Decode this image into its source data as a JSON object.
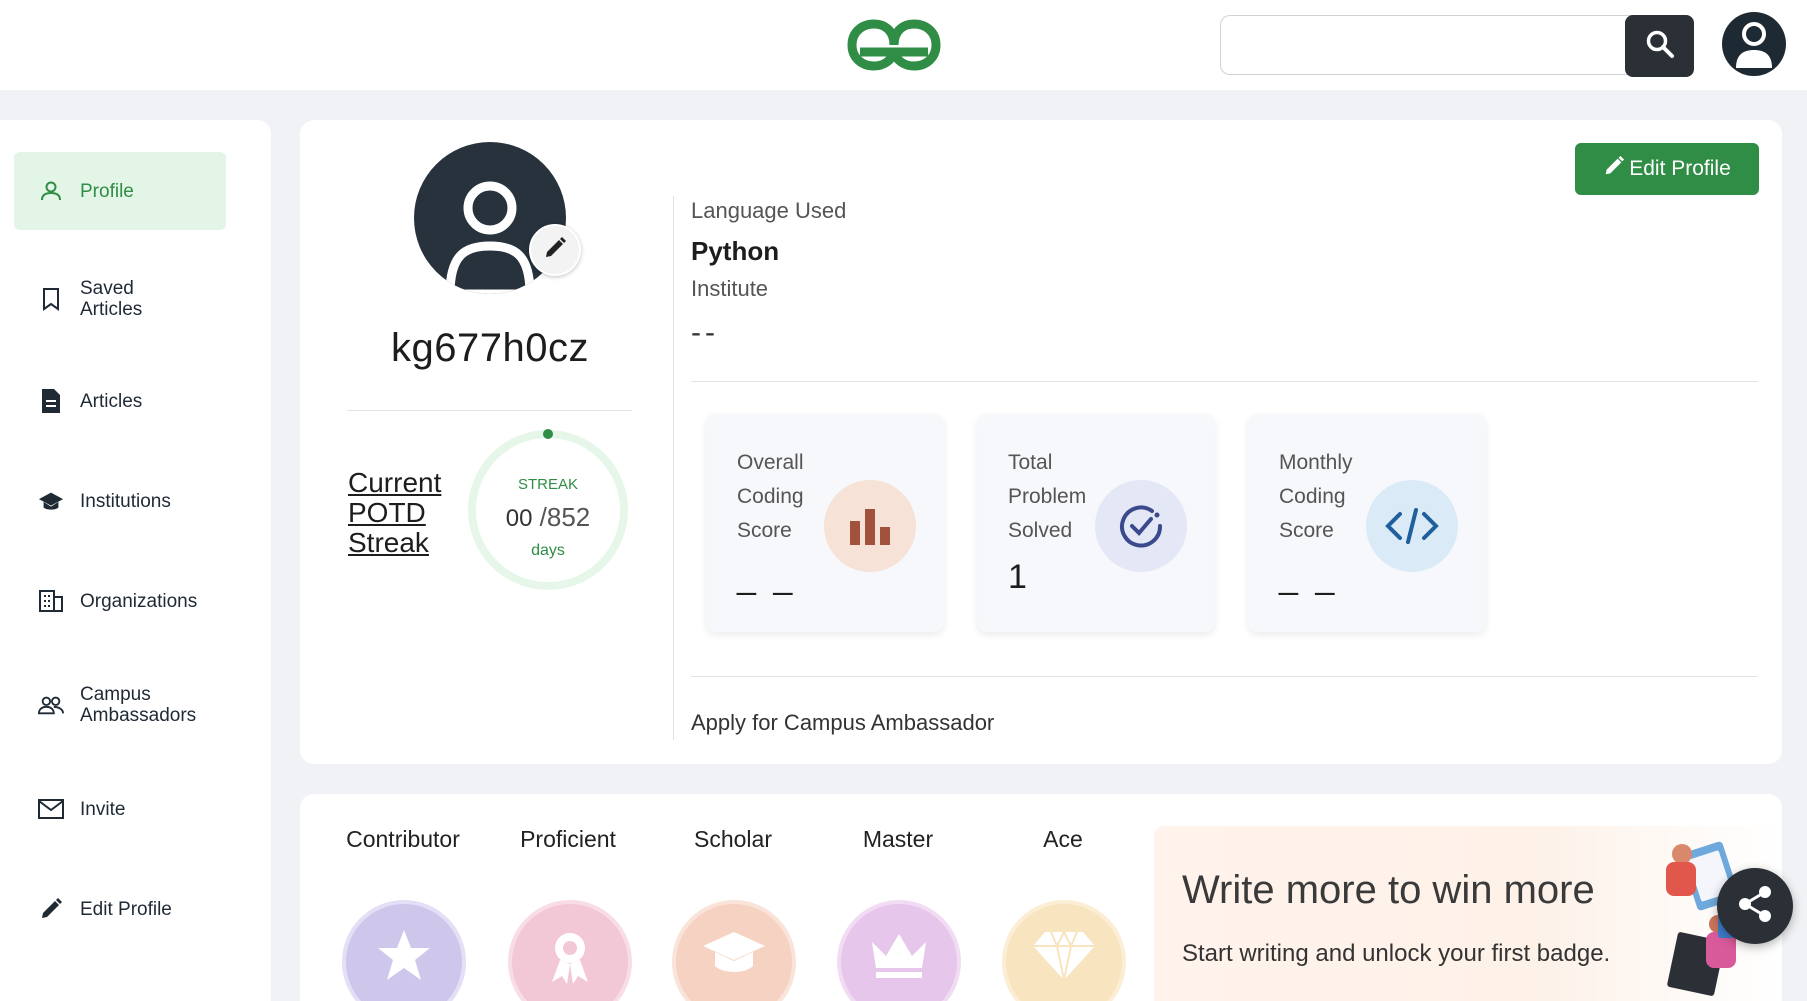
{
  "header": {
    "logo_icon": "gfg-logo-icon",
    "search_placeholder": "",
    "search_icon": "search-icon",
    "avatar_icon": "user-avatar-icon"
  },
  "sidebar": {
    "items": [
      {
        "label": "Profile",
        "icon": "user-icon",
        "active": true
      },
      {
        "label": "Saved Articles",
        "icon": "bookmark-icon"
      },
      {
        "label": "Articles",
        "icon": "document-icon"
      },
      {
        "label": "Institutions",
        "icon": "graduation-cap-icon"
      },
      {
        "label": "Organizations",
        "icon": "building-icon"
      },
      {
        "label": "Campus Ambassadors",
        "icon": "people-icon"
      },
      {
        "label": "Invite",
        "icon": "mail-icon"
      },
      {
        "label": "Edit Profile",
        "icon": "pencil-icon"
      }
    ]
  },
  "profile": {
    "username": "kg677h0cz",
    "potd_label": "Current POTD Streak",
    "streak_title": "STREAK",
    "streak_current": "00",
    "streak_total": "/852",
    "streak_unit": "days",
    "streak_progress": 0,
    "edit_button": "Edit Profile",
    "language_label": "Language Used",
    "language_value": "Python",
    "institute_label": "Institute",
    "institute_value": "--",
    "campus_link": "Apply for Campus Ambassador"
  },
  "stats": [
    {
      "label": "Overall Coding Score",
      "value": "_ _",
      "icon": "bar-chart-icon",
      "color": "#f6e2d6"
    },
    {
      "label": "Total Problem Solved",
      "value": "1",
      "icon": "check-circle-icon",
      "color": "#e4e7f5"
    },
    {
      "label": "Monthly Coding Score",
      "value": "_ _",
      "icon": "code-icon",
      "color": "#dbeaf7"
    }
  ],
  "badges": [
    {
      "name": "Contributor",
      "icon": "star-icon",
      "color": "#cfc6ec"
    },
    {
      "name": "Proficient",
      "icon": "ribbon-icon",
      "color": "#f3c8d6"
    },
    {
      "name": "Scholar",
      "icon": "graduation-cap-icon",
      "color": "#f6d2c2"
    },
    {
      "name": "Master",
      "icon": "crown-icon",
      "color": "#e6c6ea"
    },
    {
      "name": "Ace",
      "icon": "diamond-icon",
      "color": "#f8e4bf"
    }
  ],
  "promo": {
    "title": "Write more to win more",
    "subtitle": "Start writing and unlock your first badge."
  },
  "colors": {
    "brand_green": "#2f8d46",
    "dark": "#2b2f36"
  }
}
